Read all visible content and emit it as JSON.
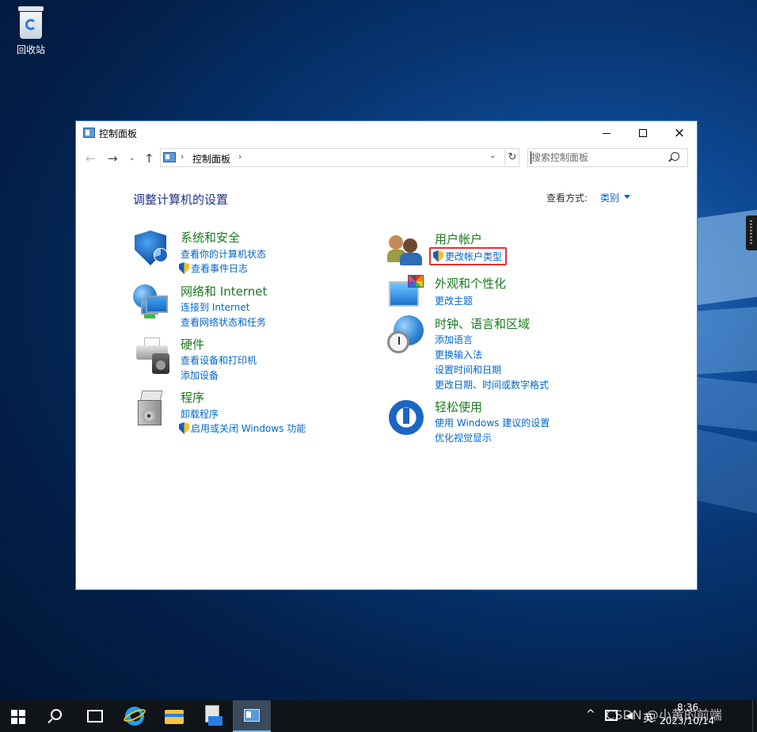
{
  "desktop": {
    "recycle_bin_label": "回收站"
  },
  "window": {
    "title": "控制面板",
    "buttons": {
      "minimize": "minimize",
      "maximize": "maximize",
      "close": "×"
    }
  },
  "address_bar": {
    "crumbs": [
      "控制面板"
    ],
    "search_placeholder": "搜索控制面板"
  },
  "content": {
    "heading": "调整计算机的设置",
    "view_by_label": "查看方式:",
    "view_by_value": "类别"
  },
  "categories": {
    "system_security": {
      "title": "系统和安全",
      "links": [
        "查看你的计算机状态",
        "查看事件日志"
      ]
    },
    "network": {
      "title": "网络和 Internet",
      "links": [
        "连接到 Internet",
        "查看网络状态和任务"
      ]
    },
    "hardware": {
      "title": "硬件",
      "links": [
        "查看设备和打印机",
        "添加设备"
      ]
    },
    "programs": {
      "title": "程序",
      "links": [
        "卸载程序",
        "启用或关闭 Windows 功能"
      ]
    },
    "user_accounts": {
      "title": "用户帐户",
      "links": [
        "更改帐户类型"
      ]
    },
    "appearance": {
      "title": "外观和个性化",
      "links": [
        "更改主题"
      ]
    },
    "clock_region": {
      "title": "时钟、语言和区域",
      "links": [
        "添加语言",
        "更换输入法",
        "设置时间和日期",
        "更改日期、时间或数字格式"
      ]
    },
    "ease_of_access": {
      "title": "轻松使用",
      "links": [
        "使用 Windows 建议的设置",
        "优化视觉显示"
      ]
    }
  },
  "taskbar": {
    "time": "8:36",
    "date": "2023/10/14",
    "language": "英",
    "tray_caret": "^"
  },
  "watermark": "CSDN @小黄的前端",
  "colors": {
    "category_title": "#197a1f",
    "link": "#0066cc",
    "heading": "#1e3287",
    "highlight_border": "#e53030"
  }
}
